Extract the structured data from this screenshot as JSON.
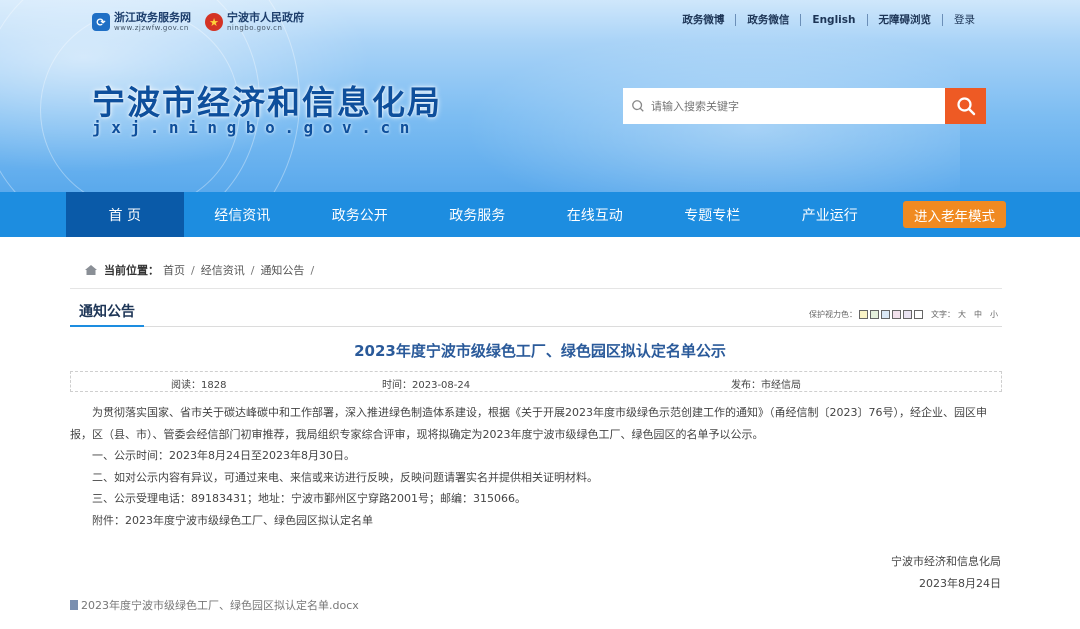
{
  "header": {
    "logo_left_title": "浙江政务服务网",
    "logo_left_url": "www.zjzwfw.gov.cn",
    "logo_right_title": "宁波市人民政府",
    "logo_right_url": "ningbo.gov.cn",
    "top_links": [
      "政务微博",
      "政务微信",
      "English",
      "无障碍浏览",
      "登录"
    ],
    "site_title": "宁波市经济和信息化局",
    "site_domain": "jxj.ningbo.gov.cn",
    "search_placeholder": "请输入搜索关键字"
  },
  "nav": {
    "items": [
      "首 页",
      "经信资讯",
      "政务公开",
      "政务服务",
      "在线互动",
      "专题专栏",
      "产业运行"
    ],
    "elder_mode": "进入老年模式"
  },
  "breadcrumb": {
    "label": "当前位置：",
    "items": [
      "首页",
      "经信资讯",
      "通知公告"
    ]
  },
  "section": {
    "tab": "通知公告",
    "eye_label": "保护视力色：",
    "text_label": "文字：",
    "sizes": [
      "大",
      "中",
      "小"
    ],
    "swatch_colors": [
      "#f9f3c6",
      "#e6f1dd",
      "#dbe8f5",
      "#f2e1ec",
      "#e9e3f1",
      "#ffffff"
    ]
  },
  "article": {
    "title": "2023年度宁波市级绿色工厂、绿色园区拟认定名单公示",
    "views": "阅读：1828",
    "date": "时间：2023-08-24",
    "source": "发布：市经信局",
    "para1_line1": "为贯彻落实国家、省市关于碳达峰碳中和工作部署，深入推进绿色制造体系建设，根据《关于开展2023年度市级绿色示范创建工作的通知》（甬经信制〔2023〕76号），经企业、园区申",
    "para1_line2": "报，区（县、市）、管委会经信部门初审推荐，我局组织专家综合评审，现将拟确定为2023年度宁波市级绿色工厂、绿色园区的名单予以公示。",
    "item1": "一、公示时间：2023年8月24日至2023年8月30日。",
    "item2": "二、如对公示内容有异议，可通过来电、来信或来访进行反映，反映问题请署实名并提供相关证明材料。",
    "item3": "三、公示受理电话：89183431；地址：宁波市鄞州区宁穿路2001号；邮编：315066。",
    "attachment_note": "附件：2023年度宁波市级绿色工厂、绿色园区拟认定名单",
    "sign_org": "宁波市经济和信息化局",
    "sign_date": "2023年8月24日",
    "attachment_file": "2023年度宁波市级绿色工厂、绿色园区拟认定名单.docx"
  }
}
